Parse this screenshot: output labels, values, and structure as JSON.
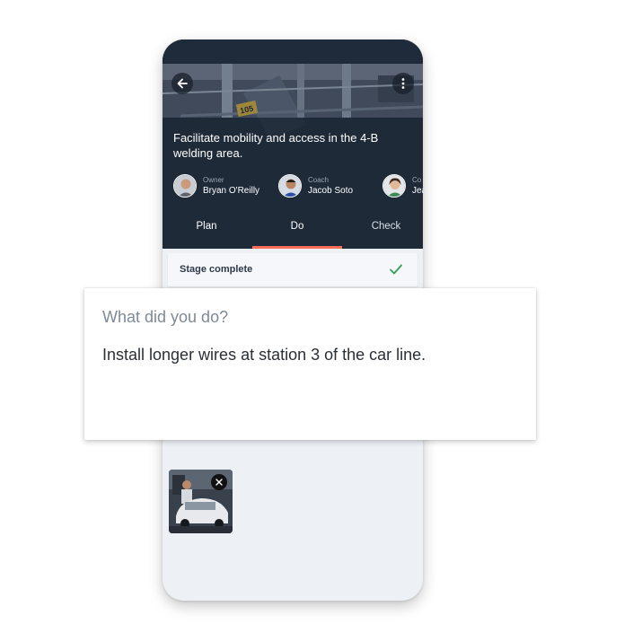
{
  "header": {
    "title": "Facilitate mobility and access in the 4-B welding area."
  },
  "people": [
    {
      "role": "Owner",
      "name": "Bryan O'Reilly"
    },
    {
      "role": "Coach",
      "name": "Jacob Soto"
    },
    {
      "role": "Co",
      "name": "Jea"
    }
  ],
  "tabs": [
    {
      "label": "Plan"
    },
    {
      "label": "Do"
    },
    {
      "label": "Check"
    }
  ],
  "stage": {
    "label": "Stage complete"
  },
  "card": {
    "question": "What did you do?",
    "answer": "Install longer wires at station 3 of the car line."
  },
  "background_sign": "105",
  "colors": {
    "hero_dark": "#1f2a3a",
    "active_tab": "#ff6d5a",
    "check_green": "#2f9e57",
    "screen_bg": "#edf1f5"
  },
  "icons": {
    "back": "arrow-left-icon",
    "more": "more-vertical-icon",
    "complete": "check-icon",
    "remove": "close-icon"
  }
}
